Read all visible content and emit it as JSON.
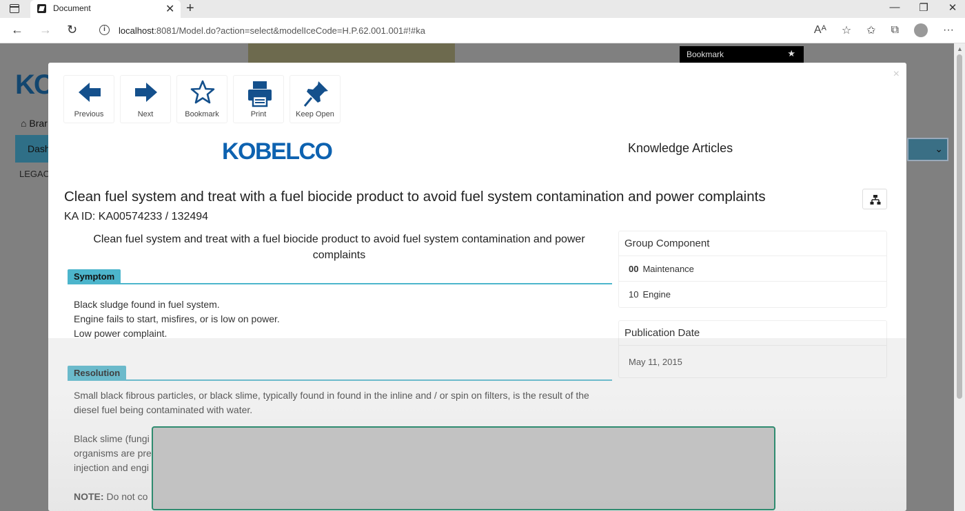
{
  "browser": {
    "tab_title": "Document",
    "url_host": "localhost",
    "url_rest": ":8081/Model.do?action=select&modelIceCode=H.P.62.001.001#!#ka"
  },
  "background": {
    "bookmark_label": "Bookmark",
    "logo_fragment": "KC",
    "brand_fragment": "Brar",
    "dash_fragment": "Dash",
    "legacy_fragment": "LEGAC"
  },
  "toolbar": {
    "previous": "Previous",
    "next": "Next",
    "bookmark": "Bookmark",
    "print": "Print",
    "keep_open": "Keep Open"
  },
  "header": {
    "brand": "KOBELCO",
    "section_title": "Knowledge Articles"
  },
  "article": {
    "title": "Clean fuel system and treat with a fuel biocide product to avoid fuel system contamination and power complaints",
    "ka_id": "KA ID: KA00574233 / 132494",
    "summary": "Clean fuel system and treat with a fuel biocide product to avoid fuel system contamination and power complaints",
    "symptom_label": "Symptom",
    "symptom_lines": [
      "Black sludge found in fuel system.",
      "Engine fails to start, misfires, or is low on power.",
      "Low power complaint."
    ],
    "resolution_label": "Resolution",
    "resolution_p1": "Small black fibrous particles, or black slime, typically found in found in the inline and / or spin on filters, is the result of the diesel fuel being contaminated with water.",
    "resolution_p2_lines": [
      "Black slime (fungi",
      "organisms are pre",
      "injection and engi"
    ],
    "note_label": "NOTE:",
    "note_text": " Do not co"
  },
  "group_component": {
    "heading": "Group Component",
    "rows": [
      {
        "code": "00",
        "name": "Maintenance"
      },
      {
        "code": "10",
        "name": "Engine"
      }
    ]
  },
  "publication": {
    "heading": "Publication Date",
    "date": "May 11, 2015"
  }
}
